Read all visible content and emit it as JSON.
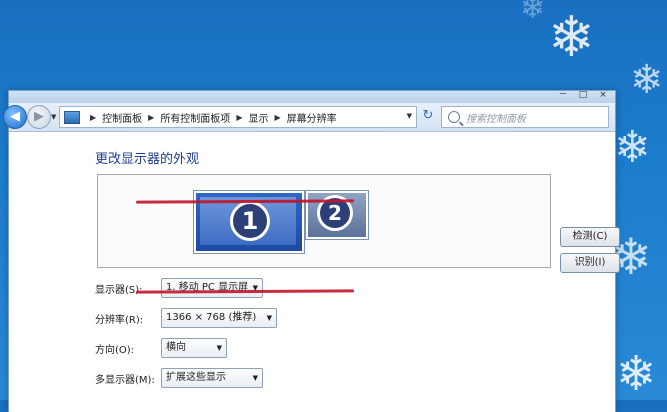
{
  "window": {
    "breadcrumbs": [
      "控制面板",
      "所有控制面板项",
      "显示",
      "屏幕分辨率"
    ],
    "search_placeholder": "搜索控制面板",
    "controls": [
      "－",
      "□",
      "×"
    ]
  },
  "page": {
    "heading": "更改显示器的外观",
    "monitors": [
      "1",
      "2"
    ],
    "detect_label": "检测(C)",
    "identify_label": "识别(I)"
  },
  "settings": {
    "display": {
      "label": "显示器(S):",
      "value": "1. 移动 PC 显示屏"
    },
    "resolution": {
      "label": "分辨率(R):",
      "value": "1366 × 768 (推荐)"
    },
    "orientation": {
      "label": "方向(O):",
      "value": "横向"
    },
    "multiple_displays": {
      "label": "多显示器(M):",
      "value": "扩展这些显示"
    }
  },
  "annotation_color": "#c0152a"
}
